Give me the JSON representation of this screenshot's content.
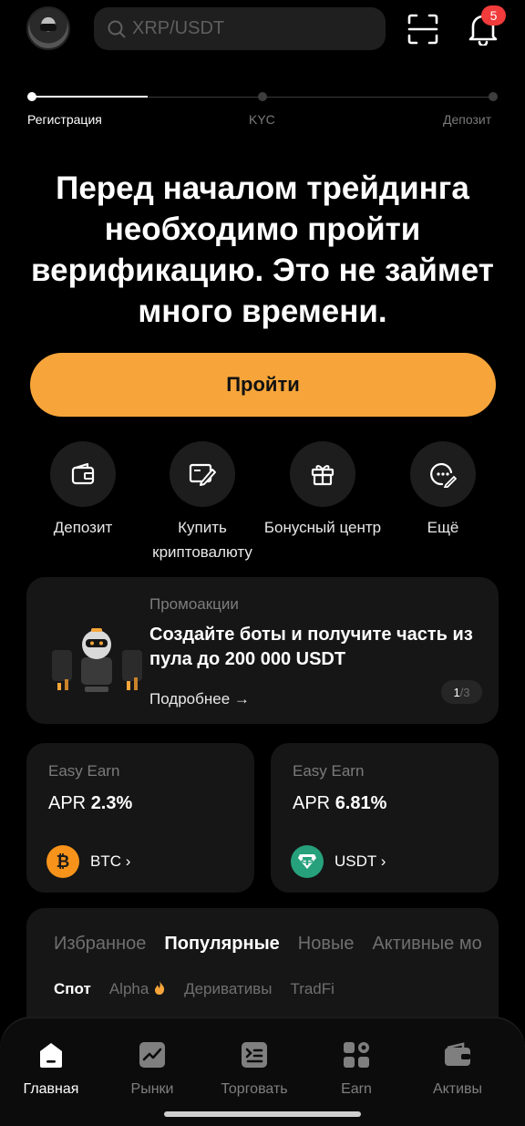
{
  "header": {
    "search_placeholder": "XRP/USDT",
    "notification_count": "5"
  },
  "progress": {
    "steps": [
      "Регистрация",
      "KYC",
      "Депозит"
    ],
    "current_step": 1
  },
  "headline": "Перед началом трейдинга необходимо пройти верификацию. Это не займет много времени.",
  "cta_label": "Пройти",
  "quick_actions": [
    {
      "label": "Депозит",
      "icon": "wallet-icon"
    },
    {
      "label": "Купить криптовалюту",
      "icon": "buy-crypto-icon"
    },
    {
      "label": "Бонусный центр",
      "icon": "gift-icon"
    },
    {
      "label": "Ещё",
      "icon": "more-icon"
    }
  ],
  "promo": {
    "category": "Промоакции",
    "title": "Создайте боты и получите часть из пула до 200 000 USDT",
    "more": "Подробнее →",
    "page_current": "1",
    "page_total": "/3"
  },
  "earn_cards": [
    {
      "category": "Easy Earn",
      "apr_prefix": "APR",
      "apr_value": "2.3%",
      "coin": "BTC ›",
      "coin_color": "#f7931a",
      "coin_icon": "bitcoin-icon"
    },
    {
      "category": "Easy Earn",
      "apr_prefix": "APR",
      "apr_value": "6.81%",
      "coin": "USDT ›",
      "coin_color": "#26a17b",
      "coin_icon": "tether-icon"
    }
  ],
  "markets": {
    "tabs": [
      "Избранное",
      "Популярные",
      "Новые",
      "Активные мо"
    ],
    "active_tab": 1,
    "subtabs": [
      "Спот",
      "Alpha",
      "Деривативы",
      "TradFi"
    ],
    "active_subtab": 0
  },
  "bottom_nav": [
    {
      "label": "Главная",
      "icon": "home-icon",
      "active": true
    },
    {
      "label": "Рынки",
      "icon": "markets-icon",
      "active": false
    },
    {
      "label": "Торговать",
      "icon": "trade-icon",
      "active": false
    },
    {
      "label": "Earn",
      "icon": "earn-icon",
      "active": false
    },
    {
      "label": "Активы",
      "icon": "assets-wallet-icon",
      "active": false
    }
  ],
  "colors": {
    "accent": "#f7a53a",
    "background": "#000000",
    "card": "#161616",
    "badge": "#f23b3b"
  }
}
